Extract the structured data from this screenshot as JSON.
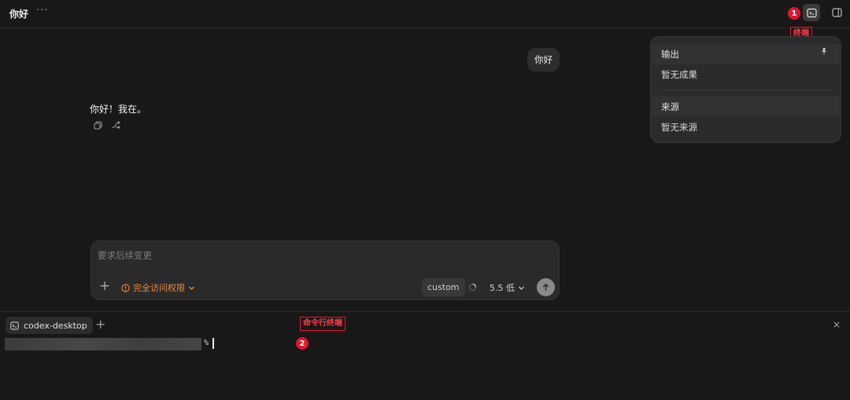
{
  "header": {
    "title": "你好",
    "more_label": "···"
  },
  "annotations": {
    "badge1": "1",
    "label_terminal": "终端",
    "badge2": "2",
    "label_cli": "命令行终端"
  },
  "dropdown": {
    "output_heading": "输出",
    "output_empty": "暂无成果",
    "source_heading": "来源",
    "source_empty": "暂无来源"
  },
  "chat": {
    "user_message": "你好",
    "assistant_message": "你好！我在。"
  },
  "composer": {
    "placeholder": "要求后续变更",
    "plus_label": "+",
    "access_label": "完全访问权限",
    "custom_label": "custom",
    "model_label": "5.5 低"
  },
  "terminal": {
    "tab_label": "codex-desktop",
    "add_label": "+",
    "close_label": "×",
    "prompt_symbol": "%"
  },
  "colors": {
    "background": "#181818",
    "accent_warning": "#f08a3c",
    "annotation_red": "#e0162b"
  }
}
